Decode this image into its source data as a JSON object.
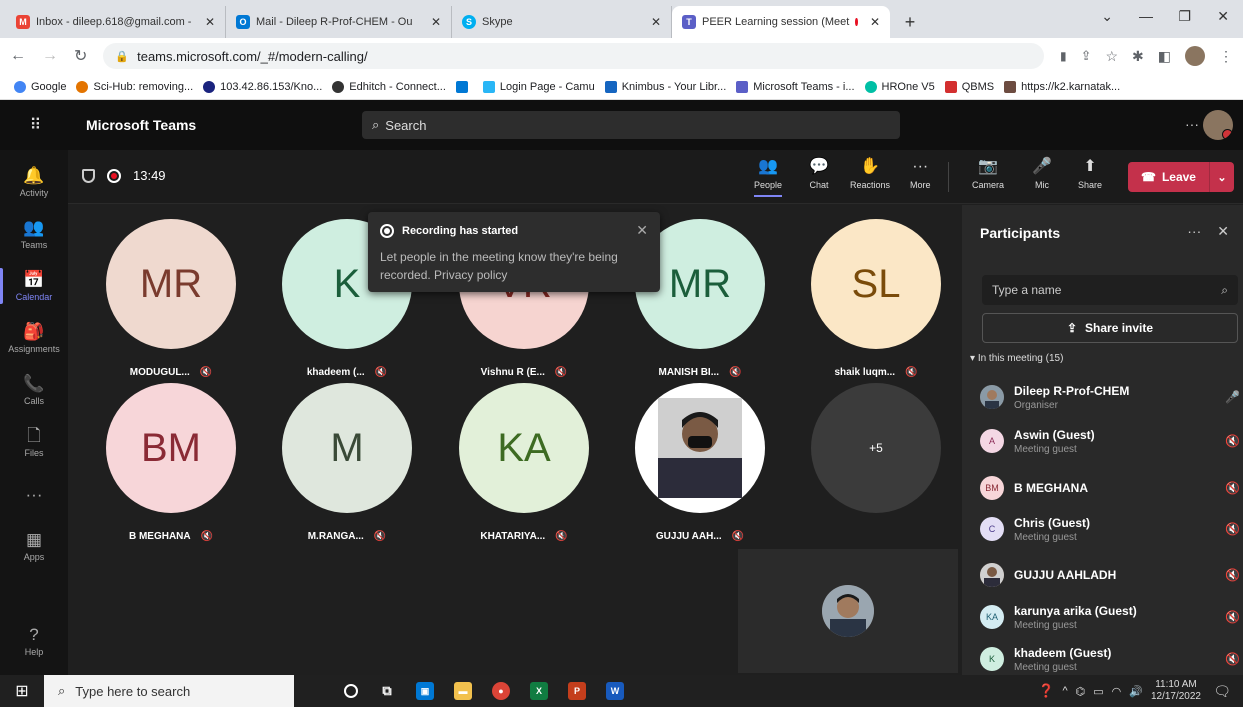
{
  "browser": {
    "tabs": [
      {
        "title": "Inbox - dileep.618@gmail.com -",
        "icon_color": "#ea4335",
        "icon": "M"
      },
      {
        "title": "Mail - Dileep R-Prof-CHEM - Ou",
        "icon_color": "#0078d4",
        "icon": "O"
      },
      {
        "title": "Skype",
        "icon_color": "#00aff0",
        "icon": "S"
      },
      {
        "title": "PEER Learning session (Meet",
        "icon_color": "#5b5fc7",
        "icon": "T",
        "active": true
      }
    ],
    "new_tab": "+",
    "url": "teams.microsoft.com/_#/modern-calling/",
    "bookmarks": [
      {
        "label": "Google",
        "color": "#4285f4"
      },
      {
        "label": "Sci-Hub: removing...",
        "color": "#e37400"
      },
      {
        "label": "103.42.86.153/Kno...",
        "color": "#1a237e"
      },
      {
        "label": "Edhitch - Connect...",
        "color": "#333333"
      },
      {
        "label": "",
        "color": "#0078d4"
      },
      {
        "label": "Login Page - Camu",
        "color": "#29b6f6"
      },
      {
        "label": "Knimbus - Your Libr...",
        "color": "#1565c0"
      },
      {
        "label": "Microsoft Teams - i...",
        "color": "#5b5fc7"
      },
      {
        "label": "HROne V5",
        "color": "#00bfa5"
      },
      {
        "label": "QBMS",
        "color": "#d32f2f"
      },
      {
        "label": "https://k2.karnatak...",
        "color": "#6d4c41"
      }
    ]
  },
  "teams": {
    "app_name": "Microsoft Teams",
    "search_placeholder": "Search",
    "rail": [
      {
        "label": "Activity",
        "icon": "🔔"
      },
      {
        "label": "Teams",
        "icon": "👥"
      },
      {
        "label": "Calendar",
        "icon": "📅",
        "active": true
      },
      {
        "label": "Assignments",
        "icon": "🎒"
      },
      {
        "label": "Calls",
        "icon": "📞"
      },
      {
        "label": "Files",
        "icon": "🗋"
      },
      {
        "label": "",
        "icon": "···"
      },
      {
        "label": "Apps",
        "icon": "▦"
      }
    ],
    "help_label": "Help",
    "timer": "13:49",
    "toolbar": {
      "people": "People",
      "chat": "Chat",
      "reactions": "Reactions",
      "more": "More",
      "camera": "Camera",
      "mic": "Mic",
      "share": "Share",
      "leave": "Leave"
    },
    "toast": {
      "title": "Recording has started",
      "body": "Let people in the meeting know they're being recorded. Privacy policy"
    },
    "tiles": [
      {
        "initials": "MR",
        "name": "MODUGUL...",
        "bg": "#efd9cf",
        "fg": "#7a3b2e"
      },
      {
        "initials": "K",
        "name": "khadeem (...",
        "bg": "#cfeee0",
        "fg": "#1b5e3b"
      },
      {
        "initials": "VR",
        "name": "Vishnu R (E...",
        "bg": "#f6d4d0",
        "fg": "#8a2a24"
      },
      {
        "initials": "MR",
        "name": "MANISH BI...",
        "bg": "#cfeee0",
        "fg": "#1b5e3b"
      },
      {
        "initials": "SL",
        "name": "shaik luqm...",
        "bg": "#fbe7c6",
        "fg": "#7a4b0a"
      },
      {
        "initials": "BM",
        "name": "B MEGHANA",
        "bg": "#f7d6d9",
        "fg": "#8a2a35"
      },
      {
        "initials": "M",
        "name": "M.RANGA...",
        "bg": "#dfe7dd",
        "fg": "#3a4a37"
      },
      {
        "initials": "KA",
        "name": "KHATARIYA...",
        "bg": "#e2f0d9",
        "fg": "#3d6b22"
      },
      {
        "initials": "",
        "name": "GUJJU AAH...",
        "bg": "#ffffff",
        "fg": "#000000"
      },
      {
        "initials": "+5",
        "name": "",
        "bg": "#3b3b3b",
        "fg": "#ffffff"
      }
    ],
    "participants": {
      "title": "Participants",
      "search_placeholder": "Type a name",
      "share_invite": "Share invite",
      "in_meeting": "In this meeting (15)",
      "list": [
        {
          "initials": "",
          "name": "Dileep R-Prof-CHEM",
          "role": "Organiser",
          "bg": "#6a5a50",
          "fg": "#fff"
        },
        {
          "initials": "A",
          "name": "Aswin (Guest)",
          "role": "Meeting guest",
          "bg": "#f4d7e4",
          "fg": "#8a2a55"
        },
        {
          "initials": "BM",
          "name": "B MEGHANA",
          "role": "",
          "bg": "#f7d6d9",
          "fg": "#8a2a35"
        },
        {
          "initials": "C",
          "name": "Chris (Guest)",
          "role": "Meeting guest",
          "bg": "#e3def5",
          "fg": "#4a3a8a"
        },
        {
          "initials": "",
          "name": "GUJJU AAHLADH",
          "role": "",
          "bg": "#8a6a50",
          "fg": "#fff"
        },
        {
          "initials": "KA",
          "name": "karunya arika (Guest)",
          "role": "Meeting guest",
          "bg": "#d4ecf2",
          "fg": "#1f5f72"
        },
        {
          "initials": "K",
          "name": "khadeem (Guest)",
          "role": "Meeting guest",
          "bg": "#cfeee0",
          "fg": "#1b5e3b"
        }
      ]
    }
  },
  "taskbar": {
    "search_placeholder": "Type here to search",
    "time": "11:10 AM",
    "date": "12/17/2022"
  }
}
